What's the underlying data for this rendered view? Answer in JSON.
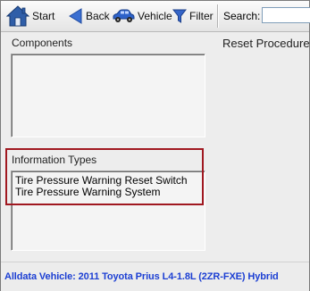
{
  "toolbar": {
    "start_label": "Start",
    "back_label": "Back",
    "vehicle_label": "Vehicle",
    "filter_label": "Filter",
    "search_label": "Search:",
    "search_value": "",
    "icons": {
      "start": "home-icon",
      "back": "back-arrow-icon",
      "vehicle": "car-icon",
      "filter": "funnel-icon"
    }
  },
  "components": {
    "label": "Components",
    "items": []
  },
  "information_types": {
    "label": "Information Types",
    "items": [
      "Tire Pressure Warning Reset Switch",
      "Tire Pressure Warning System"
    ]
  },
  "main": {
    "title": "Reset Procedure"
  },
  "status": {
    "text": "Alldata Vehicle: 2011 Toyota Prius L4-1.8L (2ZR-FXE) Hybrid"
  },
  "colors": {
    "highlight_border": "#a01820",
    "status_text": "#1c3fd3"
  }
}
